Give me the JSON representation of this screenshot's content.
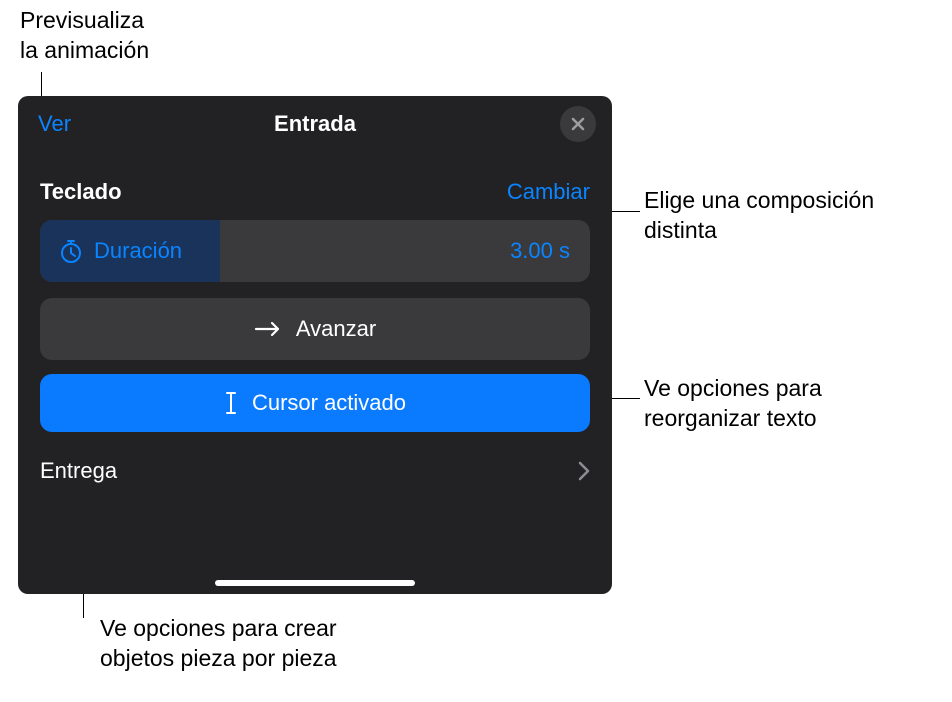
{
  "callouts": {
    "preview_top": "Previsualiza\nla animación",
    "change": "Elige una composición\ndistinta",
    "advance": "Ve opciones para\nreorganizar texto",
    "delivery": "Ve opciones para crear\nobjetos pieza por pieza"
  },
  "panel": {
    "title": "Entrada",
    "preview": "Ver",
    "section": "Teclado",
    "change": "Cambiar",
    "duration_label": "Duración",
    "duration_value": "3.00 s",
    "advance": "Avanzar",
    "cursor": "Cursor activado",
    "delivery": "Entrega"
  }
}
